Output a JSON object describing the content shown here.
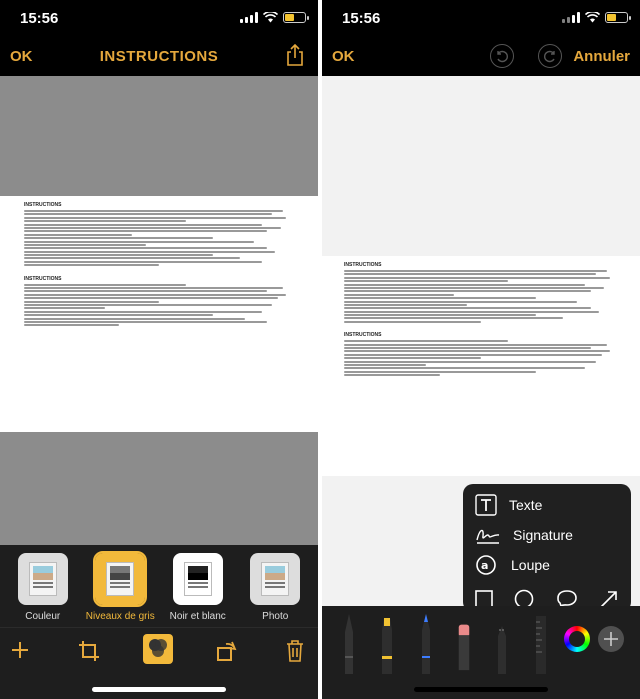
{
  "status": {
    "time": "15:56"
  },
  "left": {
    "nav": {
      "ok": "OK",
      "title": "INSTRUCTIONS"
    },
    "modes": [
      {
        "label": "Couleur"
      },
      {
        "label": "Niveaux de gris",
        "selected": true
      },
      {
        "label": "Noir et blanc"
      },
      {
        "label": "Photo"
      }
    ],
    "doc": {
      "heading1": "INSTRUCTIONS",
      "heading2": "INSTRUCTIONS"
    }
  },
  "right": {
    "nav": {
      "ok": "OK",
      "cancel": "Annuler"
    },
    "doc": {
      "heading1": "INSTRUCTIONS",
      "heading2": "INSTRUCTIONS"
    },
    "menu": {
      "text": "Texte",
      "signature": "Signature",
      "loupe": "Loupe"
    }
  },
  "colors": {
    "accent": "#e5a83d"
  }
}
